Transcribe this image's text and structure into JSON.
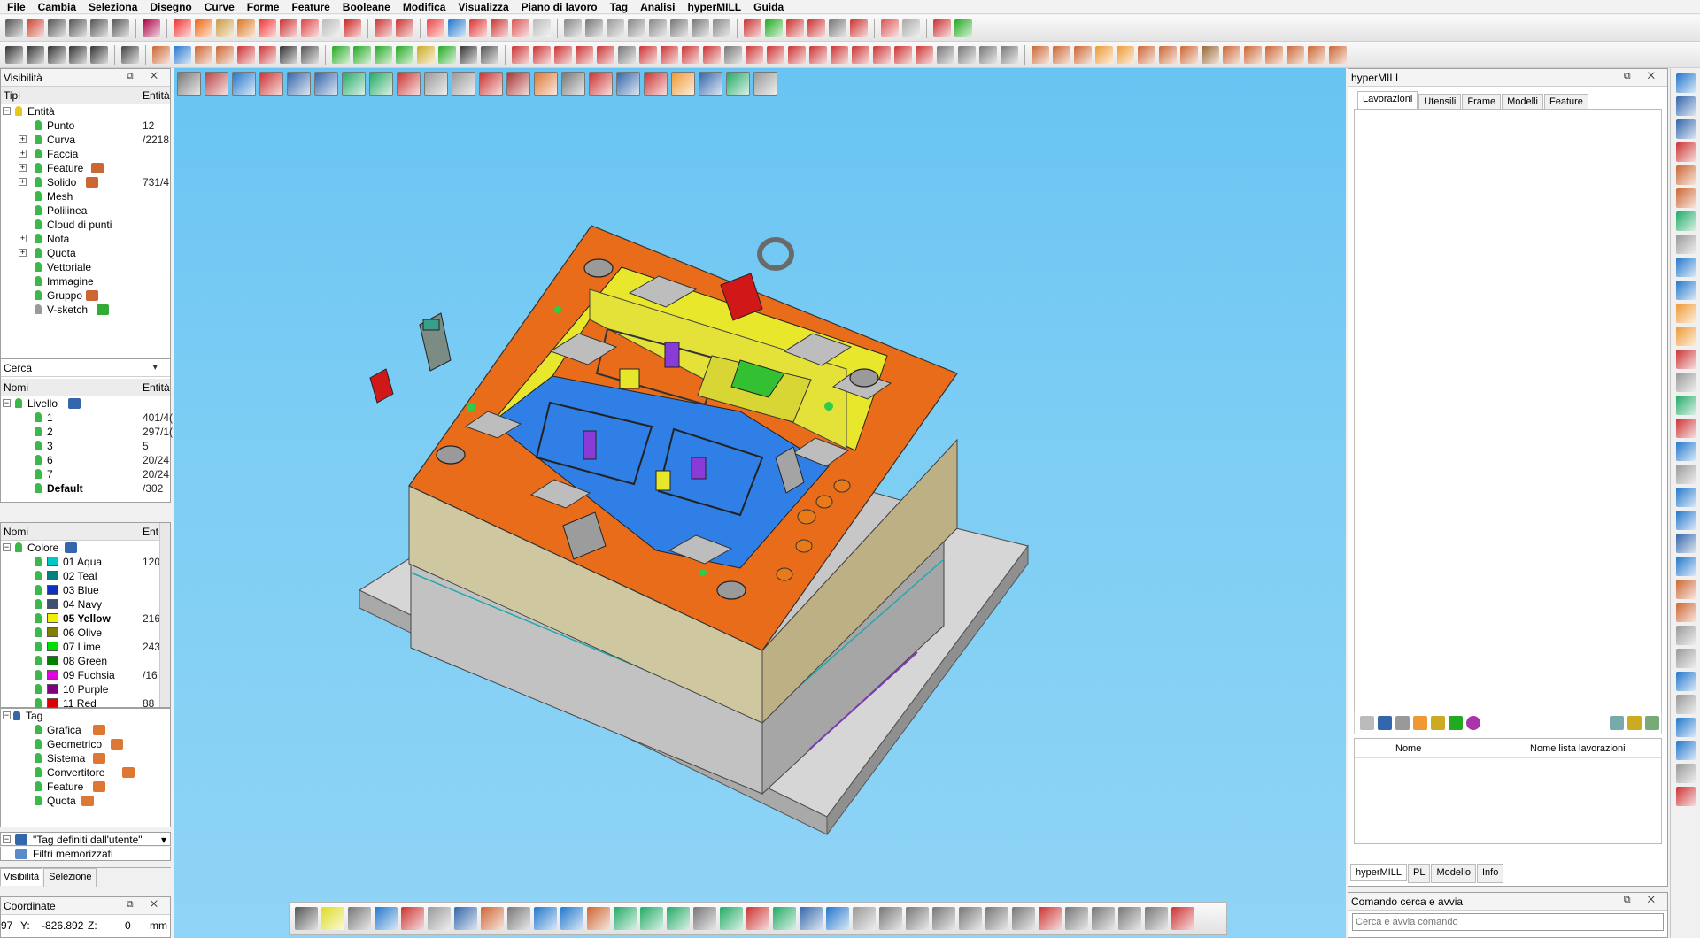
{
  "menu": [
    "File",
    "Cambia",
    "Seleziona",
    "Disegno",
    "Curve",
    "Forme",
    "Feature",
    "Booleane",
    "Modifica",
    "Visualizza",
    "Piano di lavoro",
    "Tag",
    "Analisi",
    "hyperMILL",
    "Guida"
  ],
  "toolbar_icon_colors": {
    "row1": [
      "#555",
      "#c43",
      "#555",
      "#555",
      "#555",
      "#555",
      "sep",
      "#a04",
      "sep",
      "#e33",
      "#e61",
      "#c94",
      "#d72",
      "#e33",
      "#c33",
      "#d44",
      "#bbb",
      "#c22",
      "sep",
      "#c33",
      "#c33",
      "sep",
      "#e44",
      "#27c",
      "#d33",
      "#c33",
      "#d55",
      "#bbb",
      "sep",
      "#888",
      "#777",
      "#999",
      "#888",
      "#888",
      "#777",
      "#777",
      "#888",
      "sep",
      "#c33",
      "#2a2",
      "#c33",
      "#c33",
      "#777",
      "#c33",
      "sep",
      "#d55",
      "#aaa",
      "sep",
      "#c33",
      "#2a2"
    ],
    "row2": [
      "#333",
      "#333",
      "#333",
      "#333",
      "#333",
      "sep",
      "#444",
      "sep",
      "#c63",
      "#27c",
      "#c63",
      "#c63",
      "#c33",
      "#c33",
      "#333",
      "#555",
      "sep",
      "#2a2",
      "#2a2",
      "#2a2",
      "#2a2",
      "#ca2",
      "#2a2",
      "#333",
      "#555",
      "sep",
      "#c33",
      "#c33",
      "#c33",
      "#c33",
      "#c33",
      "#777",
      "#c33",
      "#c33",
      "#c33",
      "#c33",
      "#777",
      "#c33",
      "#c33",
      "#c33",
      "#c33",
      "#c33",
      "#c33",
      "#c33",
      "#c33",
      "#c33",
      "#777",
      "#777",
      "#777",
      "#777",
      "sep",
      "#c63",
      "#c63",
      "#c63",
      "#e93",
      "#e93",
      "#c63",
      "#c63",
      "#c63",
      "#963",
      "#c63",
      "#c63",
      "#c63",
      "#c63",
      "#c63",
      "#c63"
    ]
  },
  "visibility": {
    "title": "Visibilità",
    "col_types": "Tipi",
    "col_count": "Entità",
    "root": "Entità",
    "items": [
      {
        "label": "Punto",
        "count": "12",
        "exp": false
      },
      {
        "label": "Curva",
        "count": "/2218",
        "exp": true
      },
      {
        "label": "Faccia",
        "count": "",
        "exp": true
      },
      {
        "label": "Feature",
        "count": "",
        "exp": true,
        "icon": "#c63"
      },
      {
        "label": "Solido",
        "count": "731/4",
        "exp": true,
        "icon": "#c63"
      },
      {
        "label": "Mesh",
        "count": "",
        "exp": false
      },
      {
        "label": "Polilinea",
        "count": "",
        "exp": false
      },
      {
        "label": "Cloud di punti",
        "count": "",
        "exp": false
      },
      {
        "label": "Nota",
        "count": "",
        "exp": true
      },
      {
        "label": "Quota",
        "count": "",
        "exp": true
      },
      {
        "label": "Vettoriale",
        "count": "",
        "exp": false
      },
      {
        "label": "Immagine",
        "count": "",
        "exp": false
      },
      {
        "label": "Gruppo",
        "count": "",
        "exp": false,
        "icon": "#c63"
      },
      {
        "label": "V-sketch",
        "count": "",
        "exp": false,
        "icon": "#3a3",
        "pin": "#9a9a9a"
      }
    ]
  },
  "search": {
    "label": "Cerca"
  },
  "levels": {
    "col_names": "Nomi",
    "col_count": "Entità",
    "root": "Livello",
    "items": [
      {
        "label": "1",
        "count": "401/4("
      },
      {
        "label": "2",
        "count": "297/1("
      },
      {
        "label": "3",
        "count": "5"
      },
      {
        "label": "6",
        "count": "20/24"
      },
      {
        "label": "7",
        "count": "20/24"
      },
      {
        "label": "Default",
        "count": "/302",
        "bold": true
      }
    ]
  },
  "colors": {
    "col_names": "Nomi",
    "col_count": "Ent",
    "root": "Colore",
    "items": [
      {
        "label": "01 Aqua",
        "count": "120",
        "swatch": "#00c8c8"
      },
      {
        "label": "02 Teal",
        "count": "",
        "swatch": "#008080"
      },
      {
        "label": "03 Blue",
        "count": "",
        "swatch": "#1030c0"
      },
      {
        "label": "04 Navy",
        "count": "",
        "swatch": "#405070"
      },
      {
        "label": "05 Yellow",
        "count": "216",
        "swatch": "#f0f000",
        "bold": true
      },
      {
        "label": "06 Olive",
        "count": "",
        "swatch": "#808000"
      },
      {
        "label": "07 Lime",
        "count": "243",
        "swatch": "#00e000"
      },
      {
        "label": "08 Green",
        "count": "",
        "swatch": "#008000"
      },
      {
        "label": "09 Fuchsia",
        "count": "/16",
        "swatch": "#e000e0"
      },
      {
        "label": "10 Purple",
        "count": "",
        "swatch": "#800080"
      },
      {
        "label": "11 Red",
        "count": "88",
        "swatch": "#e00000"
      }
    ]
  },
  "tags": {
    "root": "Tag",
    "items": [
      "Grafica",
      "Geometrico",
      "Sistema",
      "Convertitore",
      "Feature",
      "Quota"
    ]
  },
  "user_tags": "\"Tag definiti dall'utente\"",
  "saved_filters": "Filtri memorizzati",
  "left_tabs": [
    "Visibilità",
    "Selezione"
  ],
  "coords": {
    "title": "Coordinate",
    "x_partial": "97",
    "y_label": "Y:",
    "y": "-826.892",
    "z_label": "Z:",
    "z": "0",
    "unit": "mm"
  },
  "hypermill": {
    "title": "hyperMILL",
    "tabs": [
      "Lavorazioni",
      "Utensili",
      "Frame",
      "Modelli",
      "Feature"
    ],
    "list_headers": [
      "Nome",
      "Nome lista lavorazioni"
    ],
    "bottom_tabs": [
      "hyperMILL",
      "PL",
      "Modello",
      "Info"
    ]
  },
  "command": {
    "title": "Comando cerca e avvia",
    "placeholder": "Cerca e avvia comando"
  },
  "view_toolbar_colors": [
    "#777",
    "#b44",
    "#27c",
    "#c33",
    "#36a",
    "#36a",
    "#2a6",
    "#2a6",
    "#c33",
    "#999",
    "#999",
    "#c33",
    "#a33",
    "#d73",
    "#777",
    "#c33",
    "#36a",
    "#c33",
    "#e93",
    "#36a",
    "#2a6",
    "#999"
  ],
  "bottom_toolbar_colors": [
    "#555",
    "#dd2",
    "#777",
    "#27c",
    "#c33",
    "#999",
    "#36a",
    "#c63",
    "#777",
    "#27c",
    "#27c",
    "#c63",
    "#2a6",
    "#2a6",
    "#2a6",
    "#777",
    "#2a6",
    "#c33",
    "#2a6",
    "#36a",
    "#27c",
    "#999",
    "#777",
    "#777",
    "#777",
    "#777",
    "#777",
    "#777",
    "#c33",
    "#777",
    "#777",
    "#777",
    "#777",
    "#c33"
  ],
  "right_strip_colors": [
    "#27c",
    "#36a",
    "#36a",
    "#c33",
    "#c63",
    "#c63",
    "#2a6",
    "#999",
    "#27c",
    "#27c",
    "#e93",
    "#e93",
    "#c33",
    "#999",
    "#2a6",
    "#c33",
    "#27c",
    "#999",
    "#27c",
    "#27c",
    "#36a",
    "#27c",
    "#c63",
    "#c63",
    "#999",
    "#999",
    "#27c",
    "#999",
    "#27c",
    "#27c",
    "#999",
    "#c33"
  ]
}
